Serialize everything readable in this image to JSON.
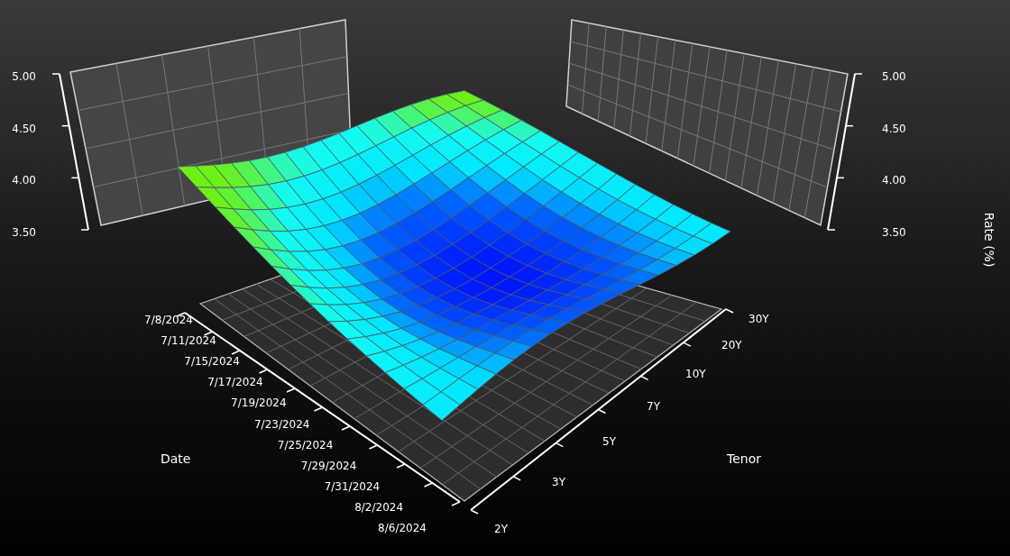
{
  "chart": {
    "rate_axis_left": {
      "ticks": [
        "5.00",
        "4.50",
        "4.00",
        "3.50"
      ]
    },
    "rate_axis_right": {
      "title": "Rate (%)",
      "ticks": [
        "5.00",
        "4.50",
        "4.00",
        "3.50"
      ]
    },
    "date_axis": {
      "title": "Date",
      "ticks": [
        "7/8/2024",
        "7/11/2024",
        "7/15/2024",
        "7/17/2024",
        "7/19/2024",
        "7/23/2024",
        "7/25/2024",
        "7/29/2024",
        "7/31/2024",
        "8/2/2024",
        "8/6/2024"
      ]
    },
    "tenor_axis": {
      "title": "Tenor",
      "ticks": [
        "30Y",
        "20Y",
        "10Y",
        "7Y",
        "5Y",
        "3Y",
        "2Y"
      ]
    }
  }
}
